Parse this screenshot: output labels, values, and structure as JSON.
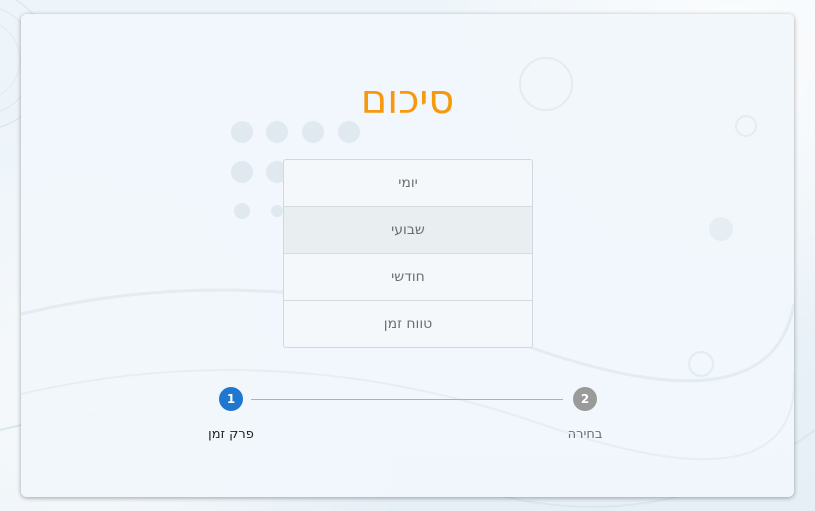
{
  "summary": {
    "title": "סיכום",
    "options": [
      {
        "label": "יומי",
        "selected": false
      },
      {
        "label": "שבועי",
        "selected": true
      },
      {
        "label": "חודשי",
        "selected": false
      },
      {
        "label": "טווח זמן",
        "selected": false
      }
    ]
  },
  "stepper": {
    "steps": [
      {
        "number": "1",
        "label": "פרק זמן",
        "active": true
      },
      {
        "number": "2",
        "label": "בחירה",
        "active": false
      }
    ]
  },
  "colors": {
    "title": "#f7990c",
    "step_active": "#1f77d0",
    "step_inactive": "#9a9a9a",
    "option_selected_bg": "#e9eef1"
  }
}
